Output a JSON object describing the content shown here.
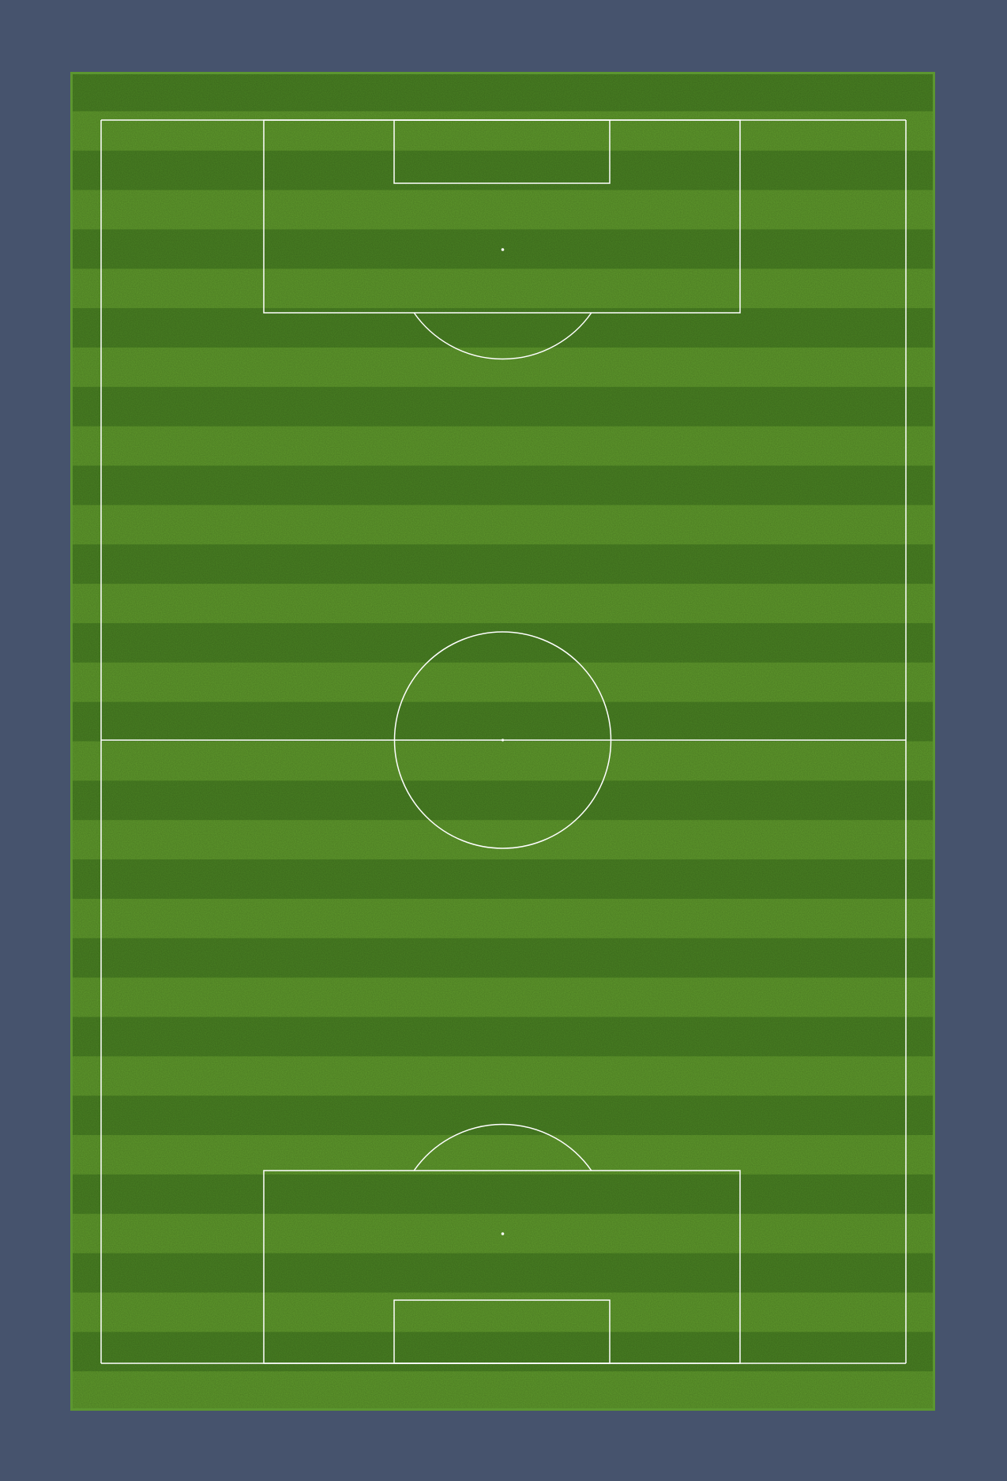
{
  "page": {
    "background_color": "#46536d"
  },
  "pitch": {
    "grass_light": "#5f9a2c",
    "grass_dark": "#4a8223",
    "border_color": "#5c9630",
    "line_color": "#ffffff",
    "stripe_count": 34,
    "markings": [
      "touchline-left",
      "touchline-right",
      "goal-line-top",
      "goal-line-bottom",
      "halfway-line",
      "center-circle",
      "center-spot",
      "penalty-area-top",
      "goal-area-top",
      "penalty-spot-top",
      "penalty-arc-top",
      "penalty-area-bottom",
      "goal-area-bottom",
      "penalty-spot-bottom",
      "penalty-arc-bottom"
    ]
  }
}
